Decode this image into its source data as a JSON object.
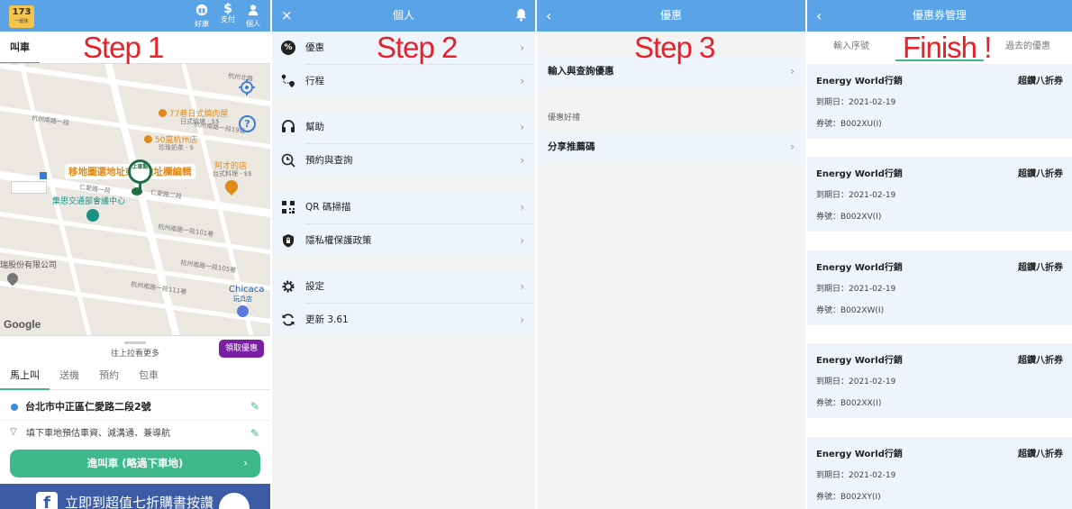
{
  "steps": [
    "Step 1",
    "Step 2",
    "Step 3",
    "Finish !"
  ],
  "panel1": {
    "logo": "173",
    "logo_sub": "一起快",
    "nav": [
      {
        "label": "好康"
      },
      {
        "label": "支付"
      },
      {
        "label": "個人"
      }
    ],
    "tab": "叫車",
    "map": {
      "poi1": "77巷日式燒肉屋",
      "poi1_sub": "日式燒烤 · $$",
      "poi2": "50嵐杭州店",
      "poi2_sub": "珍珠奶茶 · $",
      "poi3": "阿才的店",
      "poi3_sub": "台式料理 · $$",
      "poi4": "集思交通部會議中心",
      "poi5": "Chicaca",
      "poi5_sub": "玩具店",
      "poi6": "瑞股份有限公司",
      "pin": "上車點",
      "tooltip": "移地圖選地址或按地址欄編輯",
      "street1": "杭州南路一段19巷",
      "street2": "杭州南路一段",
      "street3": "仁愛路一段",
      "street4": "仁愛路二段",
      "street5": "杭州南路一段101巷",
      "street6": "杭州南路一段105巷",
      "street7": "杭州南路一段111巷",
      "street8": "杭州北路",
      "google": "Google"
    },
    "pull_hint": "往上拉看更多",
    "promo": "領取優惠",
    "ride_tabs": [
      "馬上叫",
      "送機",
      "預約",
      "包車"
    ],
    "pickup": "台北市中正區仁愛路二段2號",
    "dropoff": "填下車地預估車資、減溝通、兼導航",
    "go_button": "進叫車 (略過下車地)",
    "ad": "立即到超值七折購書按讚"
  },
  "panel2": {
    "title": "個人",
    "close": "×",
    "items": [
      "優惠",
      "行程",
      "幫助",
      "預約與查詢",
      "QR 碼掃描",
      "隱私權保護政策",
      "設定",
      "更新 3.61"
    ]
  },
  "panel3": {
    "title": "優惠",
    "back": "‹",
    "item1": "輸入與查詢優惠",
    "section": "優惠好禮",
    "item2": "分享推薦碼"
  },
  "panel4": {
    "title": "優惠券管理",
    "back": "‹",
    "tabs": [
      "輸入序號",
      "我的優惠",
      "過去的優惠"
    ],
    "coupons": [
      {
        "name": "Energy World行銷",
        "discount": "超鑽八折券",
        "expiry": "到期日：2021-02-19",
        "code": "券號：B002XU(I)"
      },
      {
        "name": "Energy World行銷",
        "discount": "超鑽八折券",
        "expiry": "到期日：2021-02-19",
        "code": "券號：B002XV(I)"
      },
      {
        "name": "Energy World行銷",
        "discount": "超鑽八折券",
        "expiry": "到期日：2021-02-19",
        "code": "券號：B002XW(I)"
      },
      {
        "name": "Energy World行銷",
        "discount": "超鑽八折券",
        "expiry": "到期日：2021-02-19",
        "code": "券號：B002XX(I)"
      },
      {
        "name": "Energy World行銷",
        "discount": "超鑽八折券",
        "expiry": "到期日：2021-02-19",
        "code": "券號：B002XY(I)"
      }
    ]
  },
  "colors": {
    "topbar": "#5aa3e6",
    "accent_green": "#3fb88c",
    "promo_purple": "#7b1fa2",
    "step_red": "#e8202a",
    "ad_blue": "#3b5ba5",
    "poi_orange": "#e08a1c",
    "poi_teal": "#1a8f86"
  }
}
